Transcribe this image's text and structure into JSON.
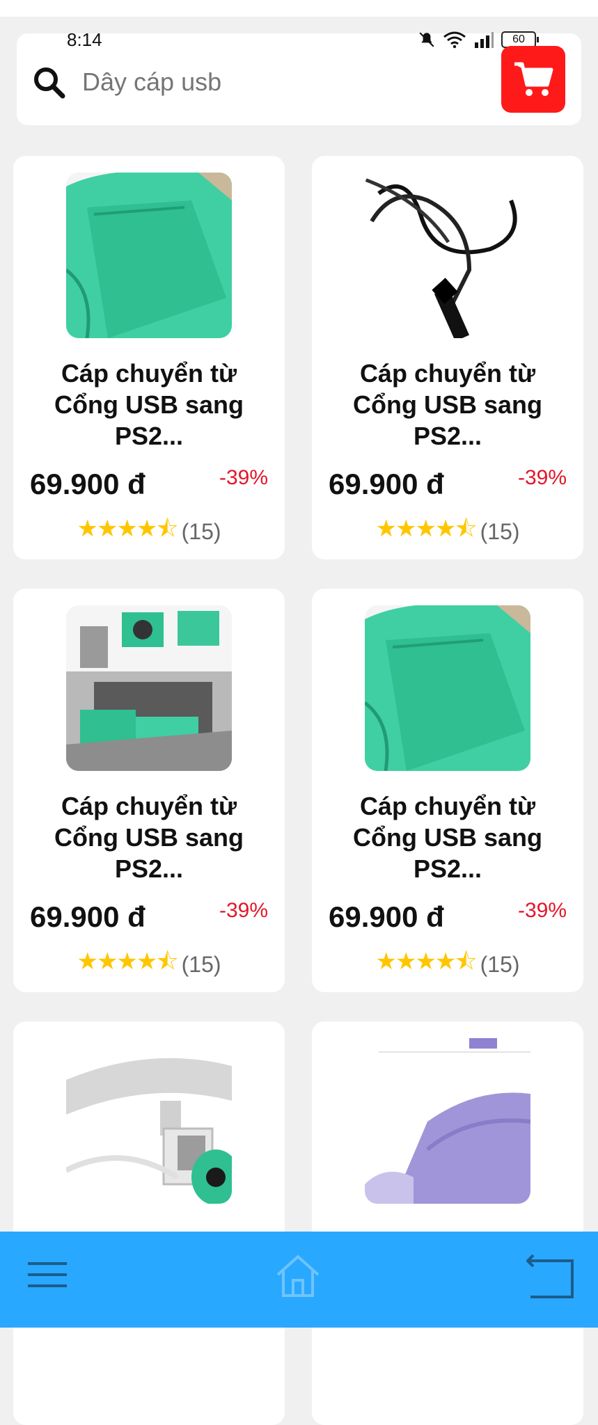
{
  "status": {
    "time": "8:14",
    "battery": "60"
  },
  "search": {
    "placeholder": "Dây cáp usb"
  },
  "products": [
    {
      "title": "Cáp chuyển từ Cổng USB sang PS2...",
      "price": "69.900 đ",
      "discount": "-39%",
      "rating_count": "(15)",
      "rating": 4.5
    },
    {
      "title": "Cáp chuyển từ Cổng USB sang PS2...",
      "price": "69.900 đ",
      "discount": "-39%",
      "rating_count": "(15)",
      "rating": 4.5
    },
    {
      "title": "Cáp chuyển từ Cổng USB sang PS2...",
      "price": "69.900 đ",
      "discount": "-39%",
      "rating_count": "(15)",
      "rating": 4.5
    },
    {
      "title": "Cáp chuyển từ Cổng USB sang PS2...",
      "price": "69.900 đ",
      "discount": "-39%",
      "rating_count": "(15)",
      "rating": 4.5
    }
  ],
  "colors": {
    "accent": "#29a8ff",
    "cart": "#ff1a1a",
    "discount": "#e3162a",
    "star": "#ffc600"
  },
  "icons": [
    "search-icon",
    "cart-icon",
    "menu-icon",
    "home-icon",
    "back-icon",
    "mute-icon",
    "wifi-icon",
    "signal-icon",
    "battery-icon"
  ]
}
